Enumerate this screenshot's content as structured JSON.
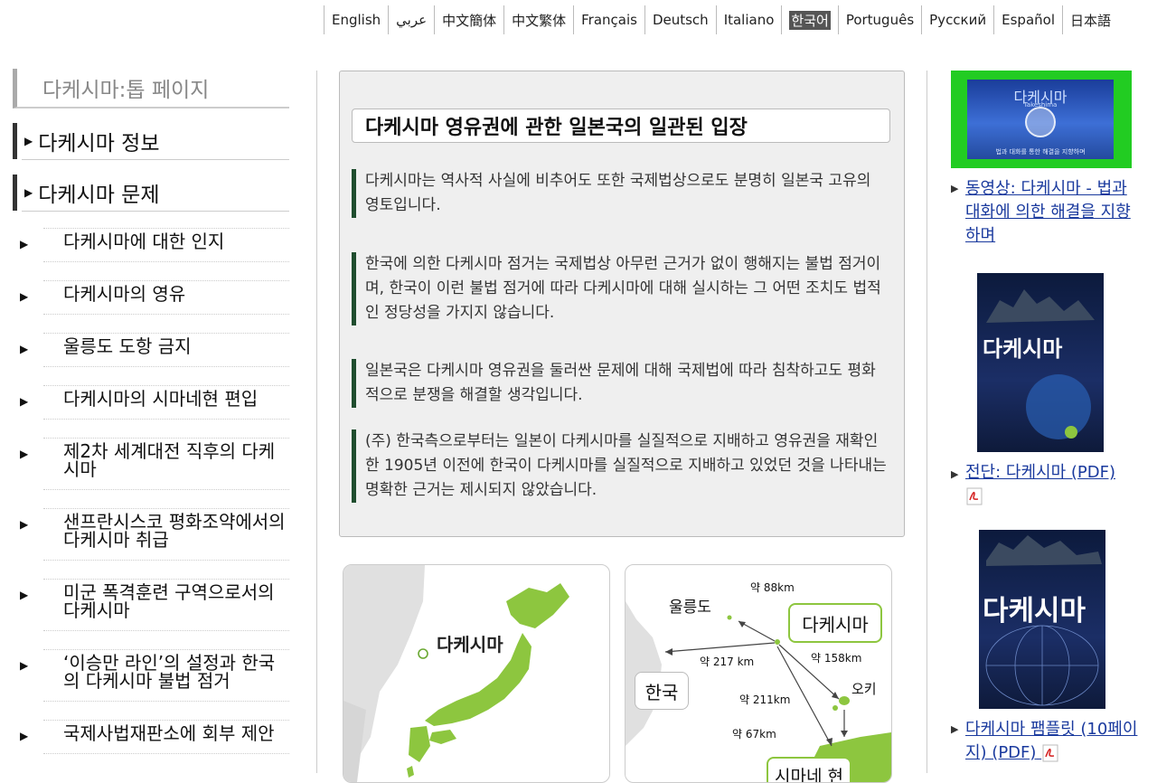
{
  "languages": [
    {
      "label": "English",
      "active": false
    },
    {
      "label": "عربي",
      "active": false
    },
    {
      "label": "中文簡体",
      "active": false
    },
    {
      "label": "中文繁体",
      "active": false
    },
    {
      "label": "Français",
      "active": false
    },
    {
      "label": "Deutsch",
      "active": false
    },
    {
      "label": "Italiano",
      "active": false
    },
    {
      "label": "한국어",
      "active": true
    },
    {
      "label": "Português",
      "active": false
    },
    {
      "label": "Русский",
      "active": false
    },
    {
      "label": "Español",
      "active": false
    },
    {
      "label": "日本語",
      "active": false
    }
  ],
  "nav": {
    "top": "다케시마:톱 페이지",
    "sections": [
      "다케시마 정보",
      "다케시마 문제"
    ],
    "items": [
      "다케시마에 대한 인지",
      "다케시마의 영유",
      "울릉도 도항 금지",
      "다케시마의 시마네현 편입",
      "제2차 세계대전 직후의 다케시마",
      "샌프란시스코 평화조약에서의 다케시마 취급",
      "미군 폭격훈련 구역으로서의 다케시마",
      "‘이승만 라인’의 설정과 한국의 다케시마 불법 점거",
      "국제사법재판소에 회부 제안"
    ]
  },
  "main": {
    "title": "다케시마 영유권에 관한 일본국의 일관된 입장",
    "paragraphs": [
      "다케시마는 역사적 사실에 비추어도 또한 국제법상으로도 분명히 일본국 고유의 영토입니다.",
      "한국에 의한 다케시마 점거는 국제법상 아무런 근거가 없이 행해지는 불법 점거이며, 한국이 이런 불법 점거에 따라 다케시마에 대해 실시하는 그 어떤 조치도 법적인 정당성을 가지지 않습니다.",
      "일본국은 다케시마 영유권을 둘러싼 문제에 대해 국제법에 따라 침착하고도 평화적으로 분쟁을 해결할 생각입니다.",
      "(주) 한국측으로부터는 일본이 다케시마를 실질적으로 지배하고 영유권을 재확인한 1905년 이전에 한국이 다케시마를 실질적으로 지배하고 있었던 것을 나타내는 명확한 근거는 제시되지 않았습니다."
    ]
  },
  "map1": {
    "label": "다케시마"
  },
  "map2": {
    "takeshima": "다케시마",
    "ulleungdo": "울릉도",
    "korea": "한국",
    "oki": "오키",
    "shimane": "시마네 현",
    "d88": "약 88km",
    "d217": "약 217 km",
    "d158": "약 158km",
    "d211": "약 211km",
    "d67": "약 67km"
  },
  "right": {
    "video_thumb_title": "다케시마",
    "video_thumb_sub": "Takeshima",
    "video_thumb_caption": "법과 대화를 통한 해결을 지향하며",
    "video_link": "동영상: 다케시마 - 법과 대화에 의한 해결을 지향하며",
    "leaflet_title": "다케시마",
    "leaflet_link": "전단: 다케시마 (PDF)",
    "pamphlet_title": "다케시마",
    "pamphlet_link": "다케시마 팸플릿 (10페이지) (PDF)"
  },
  "colors": {
    "accent_bar": "#1f4d2e",
    "link": "#1a3a9e",
    "map_land": "#8dc63f"
  }
}
